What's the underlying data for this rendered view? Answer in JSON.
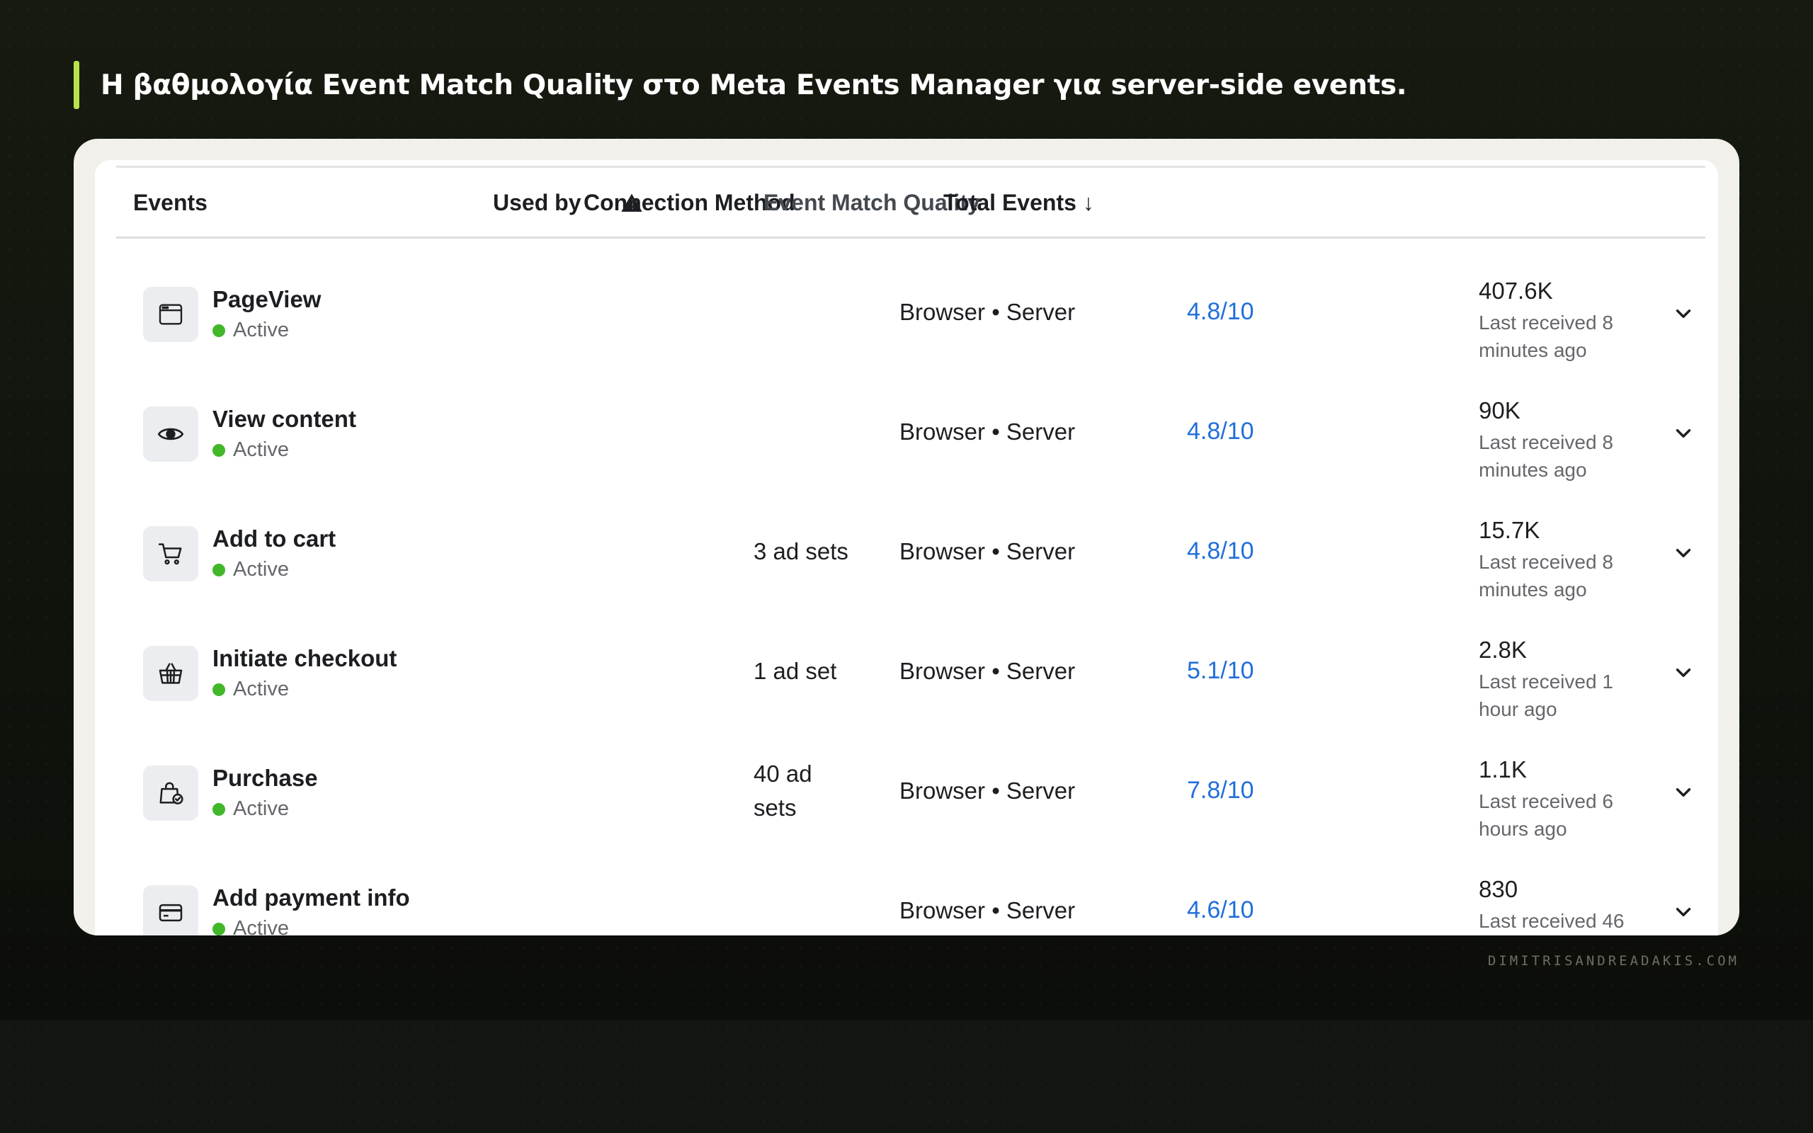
{
  "headline": "Η βαθμολογία Event Match Quality στο Meta Events Manager για server-side events.",
  "footer": "DIMITRISANDREADAKIS.COM",
  "colors": {
    "accent": "#b7e34a",
    "link_blue": "#216fdb",
    "status_green": "#42b72a"
  },
  "table": {
    "headers": {
      "events": "Events",
      "warning_icon": "warning-icon",
      "used_by": "Used by",
      "connection_method": "Connection Method",
      "event_match_quality": "Event Match Quality",
      "total_events": "Total Events ↓"
    },
    "rows": [
      {
        "icon": "browser-window-icon",
        "name": "PageView",
        "status": "Active",
        "used_by": "",
        "connection": "Browser • Server",
        "emq": "4.8/10",
        "total": "407.6K",
        "last_received": "Last received 8 minutes ago"
      },
      {
        "icon": "eye-icon",
        "name": "View content",
        "status": "Active",
        "used_by": "",
        "connection": "Browser • Server",
        "emq": "4.8/10",
        "total": "90K",
        "last_received": "Last received 8 minutes ago"
      },
      {
        "icon": "shopping-cart-icon",
        "name": "Add to cart",
        "status": "Active",
        "used_by": "3 ad sets",
        "connection": "Browser • Server",
        "emq": "4.8/10",
        "total": "15.7K",
        "last_received": "Last received 8 minutes ago"
      },
      {
        "icon": "basket-icon",
        "name": "Initiate checkout",
        "status": "Active",
        "used_by": "1 ad set",
        "connection": "Browser • Server",
        "emq": "5.1/10",
        "total": "2.8K",
        "last_received": "Last received 1 hour ago"
      },
      {
        "icon": "shopping-bag-icon",
        "name": "Purchase",
        "status": "Active",
        "used_by": "40 ad sets",
        "connection": "Browser • Server",
        "emq": "7.8/10",
        "total": "1.1K",
        "last_received": "Last received 6 hours ago"
      },
      {
        "icon": "credit-card-icon",
        "name": "Add payment info",
        "status": "Active",
        "used_by": "",
        "connection": "Browser • Server",
        "emq": "4.6/10",
        "total": "830",
        "last_received": "Last received 46"
      }
    ]
  }
}
